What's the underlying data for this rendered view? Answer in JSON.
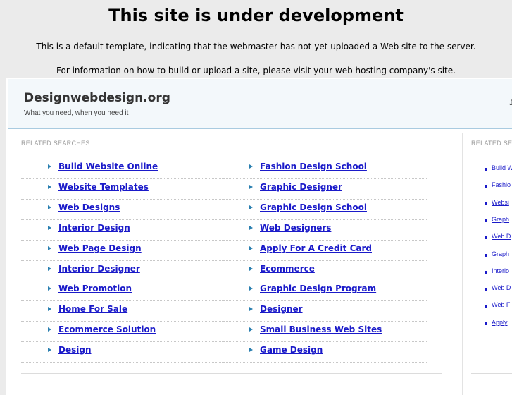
{
  "notice": {
    "title": "This site is under development",
    "line1": "This is a default template, indicating that the webmaster has not yet uploaded a Web site to the server.",
    "line2": "For information on how to build or upload a site, please visit your web hosting company's site."
  },
  "site": {
    "title": "Designwebdesign.org",
    "tagline": "What you need, when you need it",
    "header_right": "J"
  },
  "related": {
    "label": "RELATED SEARCHES",
    "left": [
      "Build Website Online",
      "Website Templates",
      "Web Designs",
      "Interior Design",
      "Web Page Design",
      "Interior Designer",
      "Web Promotion",
      "Home For Sale",
      "Ecommerce Solution",
      "Design"
    ],
    "right": [
      "Fashion Design School",
      "Graphic Designer",
      "Graphic Design School",
      "Web Designers",
      "Apply For A Credit Card",
      "Ecommerce",
      "Graphic Design Program",
      "Designer",
      "Small Business Web Sites",
      "Game Design"
    ]
  },
  "sidebar": {
    "label": "RELATED SEA",
    "links": [
      "Build W",
      "Fashio",
      "Websi",
      "Graph",
      "Web D",
      "Graph",
      "Interio",
      "Web D",
      "Web F",
      "Apply"
    ]
  },
  "colors": {
    "link": "#1a1ac9",
    "arrow": "#2a7fb0",
    "header_bg": "#f3f8fb",
    "page_bg": "#ebebeb"
  }
}
